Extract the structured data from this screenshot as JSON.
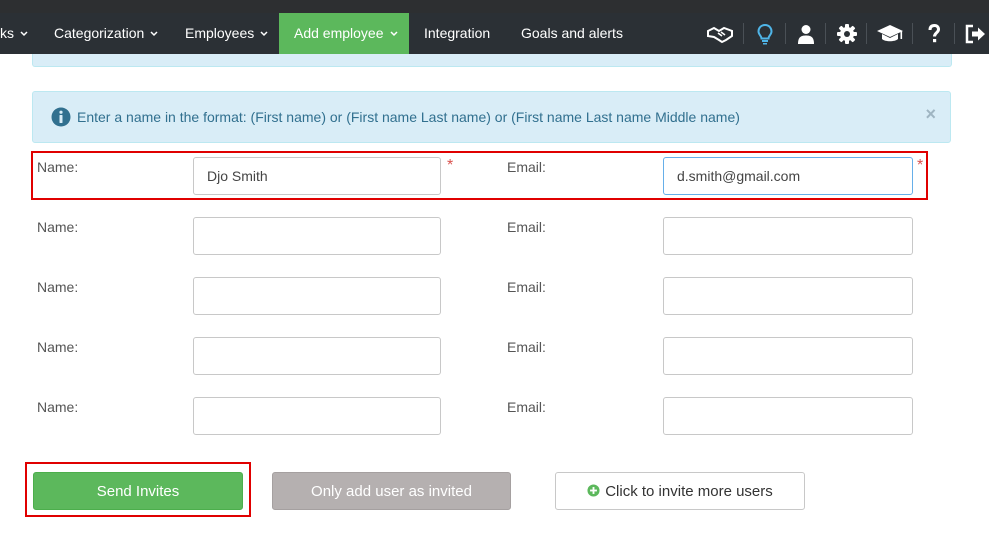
{
  "nav": {
    "items": [
      {
        "label": "ks",
        "has_caret": true,
        "active": false
      },
      {
        "label": "Categorization",
        "has_caret": true,
        "active": false
      },
      {
        "label": "Employees",
        "has_caret": true,
        "active": false
      },
      {
        "label": "Add employee",
        "has_caret": true,
        "active": true
      },
      {
        "label": "Integration",
        "has_caret": false,
        "active": false
      },
      {
        "label": "Goals and alerts",
        "has_caret": false,
        "active": false
      }
    ],
    "icons": [
      "handshake-icon",
      "lightbulb-icon",
      "user-icon",
      "gear-icon",
      "graduation-cap-icon",
      "question-icon",
      "logout-icon"
    ],
    "active_color": "#5cb85c",
    "background": "#2b3035"
  },
  "alert": {
    "text": "Enter a name in the format: (First name) or (First name Last name) or (First name Last name Middle name)",
    "close": "×",
    "icon": "info-icon"
  },
  "form": {
    "name_label": "Name:",
    "email_label": "Email:",
    "required_mark": "*",
    "rows": [
      {
        "name": "Djo Smith",
        "email": "d.smith@gmail.com"
      },
      {
        "name": "",
        "email": ""
      },
      {
        "name": "",
        "email": ""
      },
      {
        "name": "",
        "email": ""
      },
      {
        "name": "",
        "email": ""
      }
    ]
  },
  "actions": {
    "send_invites": "Send Invites",
    "only_add_invited": "Only add user as invited",
    "invite_more": "Click to invite more users",
    "invite_more_icon": "plus-circle-icon"
  },
  "colors": {
    "highlight": "#e00000",
    "primary_green": "#5cb85c",
    "alert_bg": "#d9edf7",
    "alert_text": "#31708f"
  }
}
